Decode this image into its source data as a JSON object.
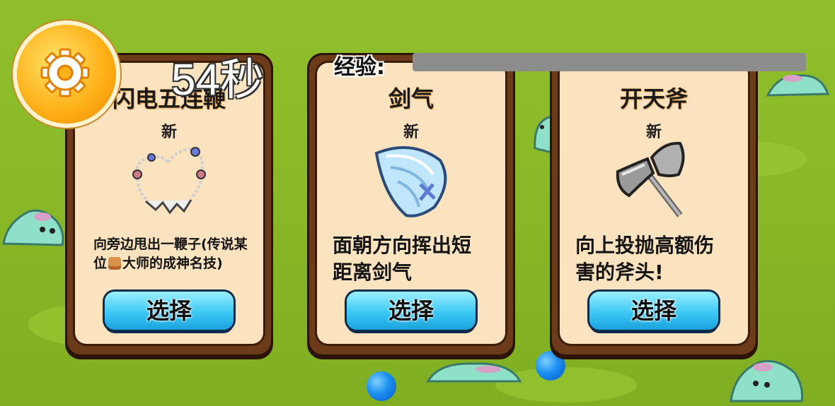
{
  "hud": {
    "timer": "54秒",
    "exp_label": "经验:",
    "exp_progress": 0.0
  },
  "cards": [
    {
      "title": "闪电五连鞭",
      "badge": "新",
      "icon": "whip-necklace-icon",
      "desc_line1": "向旁边甩出一鞭子(传说某",
      "desc_line2_pre": "位",
      "desc_line2_post": "大师的成神名技)",
      "button": "选择"
    },
    {
      "title": "剑气",
      "badge": "新",
      "icon": "sword-wind-icon",
      "desc_line1": "面朝方向挥出短",
      "desc_line2": "距离剑气",
      "button": "选择"
    },
    {
      "title": "开天斧",
      "badge": "新",
      "icon": "battle-axe-icon",
      "desc_line1": "向上投抛高额伤",
      "desc_line2": "害的斧头!",
      "button": "选择"
    }
  ]
}
